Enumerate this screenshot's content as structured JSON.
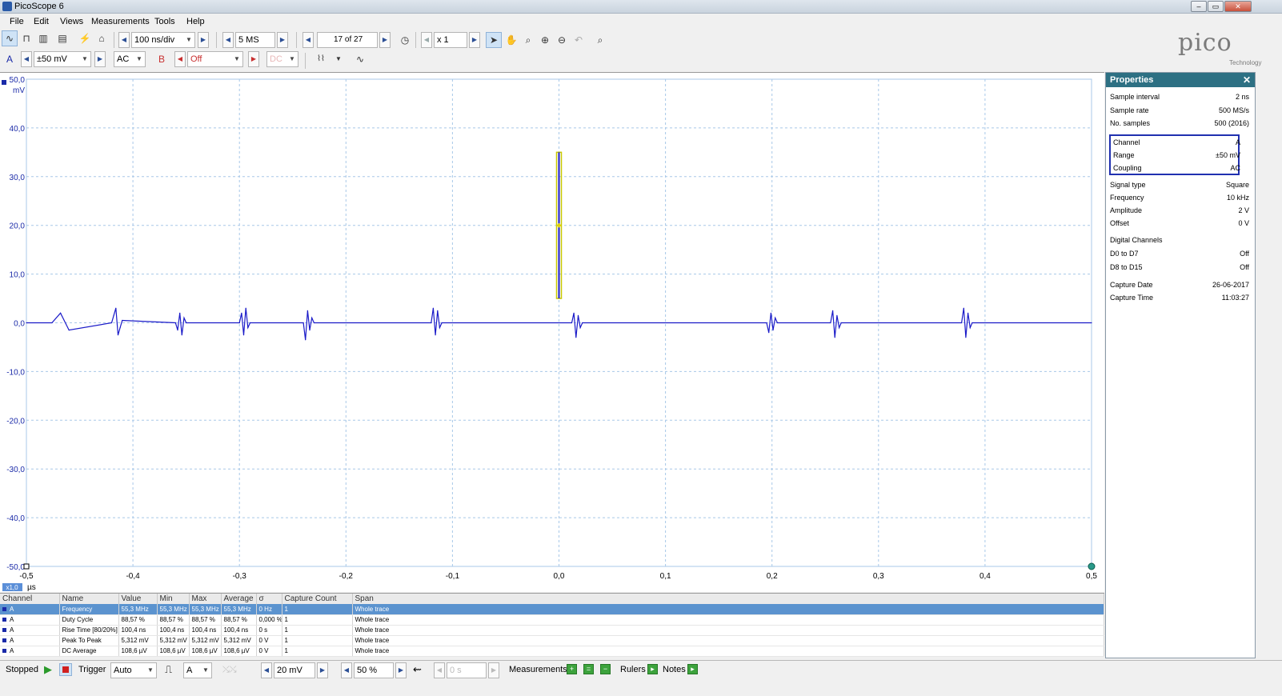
{
  "app": {
    "title": "PicoScope 6"
  },
  "window_buttons": [
    "–",
    "▭",
    "✕"
  ],
  "menu": [
    "File",
    "Edit",
    "Views",
    "Measurements",
    "Tools",
    "Help"
  ],
  "toolbar1": {
    "timebase": "100 ns/div",
    "samples": "5 MS",
    "buffer": "17 of 27",
    "zoom": "x 1"
  },
  "toolbar2": {
    "channel_a_label": "A",
    "channel_a_range": "±50 mV",
    "channel_a_coupling": "AC",
    "channel_b_label": "B",
    "channel_b_range": "Off",
    "channel_b_coupling": "DC"
  },
  "brand": {
    "name": "pico",
    "sub": "Technology"
  },
  "scope": {
    "y_unit": "mV",
    "x_unit": "µs",
    "zoom_badge": "x1,0",
    "y_ticks": [
      "50,0",
      "40,0",
      "30,0",
      "20,0",
      "10,0",
      "0,0",
      "-10,0",
      "-20,0",
      "-30,0",
      "-40,0",
      "-50,0"
    ],
    "x_ticks": [
      "-0,5",
      "-0,4",
      "-0,3",
      "-0,2",
      "-0,1",
      "0,0",
      "0,1",
      "0,2",
      "0,3",
      "0,4",
      "0,5"
    ],
    "trace_color": "#1a1ac8"
  },
  "chart_data": {
    "type": "line",
    "xlabel": "µs",
    "ylabel": "mV",
    "xlim": [
      -0.5,
      0.5
    ],
    "ylim": [
      -50,
      50
    ],
    "grid": true,
    "series": [
      {
        "x": [
          -0.5,
          -0.476,
          -0.468,
          -0.46,
          -0.42,
          -0.418,
          -0.416,
          -0.414,
          -0.412,
          -0.41,
          -0.36,
          -0.358,
          -0.356,
          -0.354,
          -0.352,
          -0.35,
          -0.3,
          -0.298,
          -0.296,
          -0.294,
          -0.292,
          -0.29,
          -0.24,
          -0.238,
          -0.236,
          -0.234,
          -0.232,
          -0.23,
          -0.12,
          -0.118,
          -0.116,
          -0.114,
          -0.112,
          -0.11,
          0.012,
          0.014,
          0.016,
          0.018,
          0.02,
          0.022,
          0.195,
          0.197,
          0.199,
          0.201,
          0.203,
          0.205,
          0.255,
          0.257,
          0.259,
          0.261,
          0.263,
          0.265,
          0.378,
          0.38,
          0.382,
          0.384,
          0.386,
          0.388,
          0.5
        ],
        "y": [
          0,
          0,
          2,
          -1.5,
          0,
          1.5,
          3,
          -2.5,
          -1,
          0.5,
          0,
          -1.5,
          2,
          -2.5,
          1,
          0,
          0,
          2,
          -2.5,
          3,
          -1,
          0,
          0,
          -3.5,
          2.5,
          -1.5,
          1,
          0,
          0,
          3,
          -2.5,
          2.5,
          -1,
          0,
          0,
          2,
          -3,
          1.5,
          -1,
          0,
          0,
          -2,
          2,
          -1.5,
          1,
          0,
          0,
          2.5,
          -3,
          1.5,
          -1,
          0,
          0,
          3,
          -3,
          2,
          -1,
          0,
          0
        ]
      }
    ]
  },
  "properties": {
    "title": "Properties",
    "close": "✕",
    "rows": [
      {
        "k": "Sample interval",
        "v": "2 ns"
      },
      {
        "k": "Sample rate",
        "v": "500 MS/s"
      },
      {
        "k": "No. samples",
        "v": "500  (2016)"
      },
      {
        "k": "Channel",
        "v": "A"
      },
      {
        "k": "Range",
        "v": "±50 mV"
      },
      {
        "k": "Coupling",
        "v": "AC"
      },
      {
        "k": "Signal type",
        "v": "Square"
      },
      {
        "k": "Frequency",
        "v": "10 kHz"
      },
      {
        "k": "Amplitude",
        "v": "2 V"
      },
      {
        "k": "Offset",
        "v": "0 V"
      },
      {
        "k": "Digital Channels",
        "v": ""
      },
      {
        "k": "D0 to D7",
        "v": "Off"
      },
      {
        "k": "D8 to D15",
        "v": "Off"
      },
      {
        "k": "Capture Date",
        "v": "26-06-2017"
      },
      {
        "k": "Capture Time",
        "v": "11:03:27"
      }
    ]
  },
  "measurements": {
    "columns": [
      "Channel",
      "Name",
      "Value",
      "Min",
      "Max",
      "Average",
      "σ",
      "Capture Count",
      "Span"
    ],
    "rows": [
      [
        "A",
        "Frequency",
        "55,3 MHz",
        "55,3 MHz",
        "55,3 MHz",
        "55,3 MHz",
        "0 Hz",
        "1",
        "Whole trace"
      ],
      [
        "A",
        "Duty Cycle",
        "88,57 %",
        "88,57 %",
        "88,57 %",
        "88,57 %",
        "0,000 %",
        "1",
        "Whole trace"
      ],
      [
        "A",
        "Rise Time  [80/20%]",
        "100,4 ns",
        "100,4 ns",
        "100,4 ns",
        "100,4 ns",
        "0 s",
        "1",
        "Whole trace"
      ],
      [
        "A",
        "Peak To Peak",
        "5,312 mV",
        "5,312 mV",
        "5,312 mV",
        "5,312 mV",
        "0 V",
        "1",
        "Whole trace"
      ],
      [
        "A",
        "DC Average",
        "108,6 µV",
        "108,6 µV",
        "108,6 µV",
        "108,6 µV",
        "0 V",
        "1",
        "Whole trace"
      ]
    ]
  },
  "status": {
    "state": "Stopped",
    "trigger_label": "Trigger",
    "trigger_mode": "Auto",
    "trigger_channel": "A",
    "threshold": "20 mV",
    "pretrigger": "50 %",
    "delay": "0 s",
    "measurements_label": "Measurements",
    "rulers_label": "Rulers",
    "notes_label": "Notes"
  }
}
